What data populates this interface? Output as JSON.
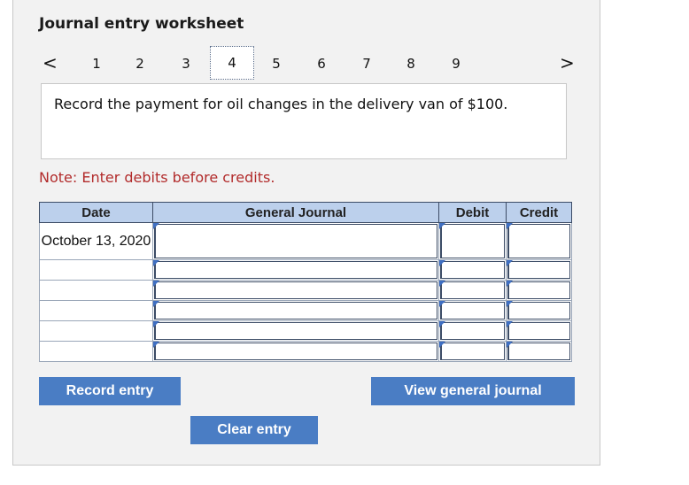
{
  "worksheet": {
    "title": "Journal entry worksheet",
    "pager": {
      "prev": "<",
      "next": ">",
      "pages": [
        "1",
        "2",
        "3",
        "4",
        "5",
        "6",
        "7",
        "8",
        "9"
      ],
      "active_page": "4"
    },
    "prompt": "Record the payment for oil changes in the delivery van of $100.",
    "note": "Note: Enter debits before credits."
  },
  "journal_table": {
    "headers": {
      "date": "Date",
      "account": "General Journal",
      "debit": "Debit",
      "credit": "Credit"
    },
    "rows": [
      {
        "date": "October 13, 2020",
        "account": "",
        "debit": "",
        "credit": ""
      },
      {
        "date": "",
        "account": "",
        "debit": "",
        "credit": ""
      },
      {
        "date": "",
        "account": "",
        "debit": "",
        "credit": ""
      },
      {
        "date": "",
        "account": "",
        "debit": "",
        "credit": ""
      },
      {
        "date": "",
        "account": "",
        "debit": "",
        "credit": ""
      },
      {
        "date": "",
        "account": "",
        "debit": "",
        "credit": ""
      }
    ]
  },
  "buttons": {
    "record": "Record entry",
    "view": "View general journal",
    "clear": "Clear entry"
  },
  "colors": {
    "button": "#4a7dc4",
    "header": "#bcd0ec",
    "note": "#b22b2b"
  }
}
